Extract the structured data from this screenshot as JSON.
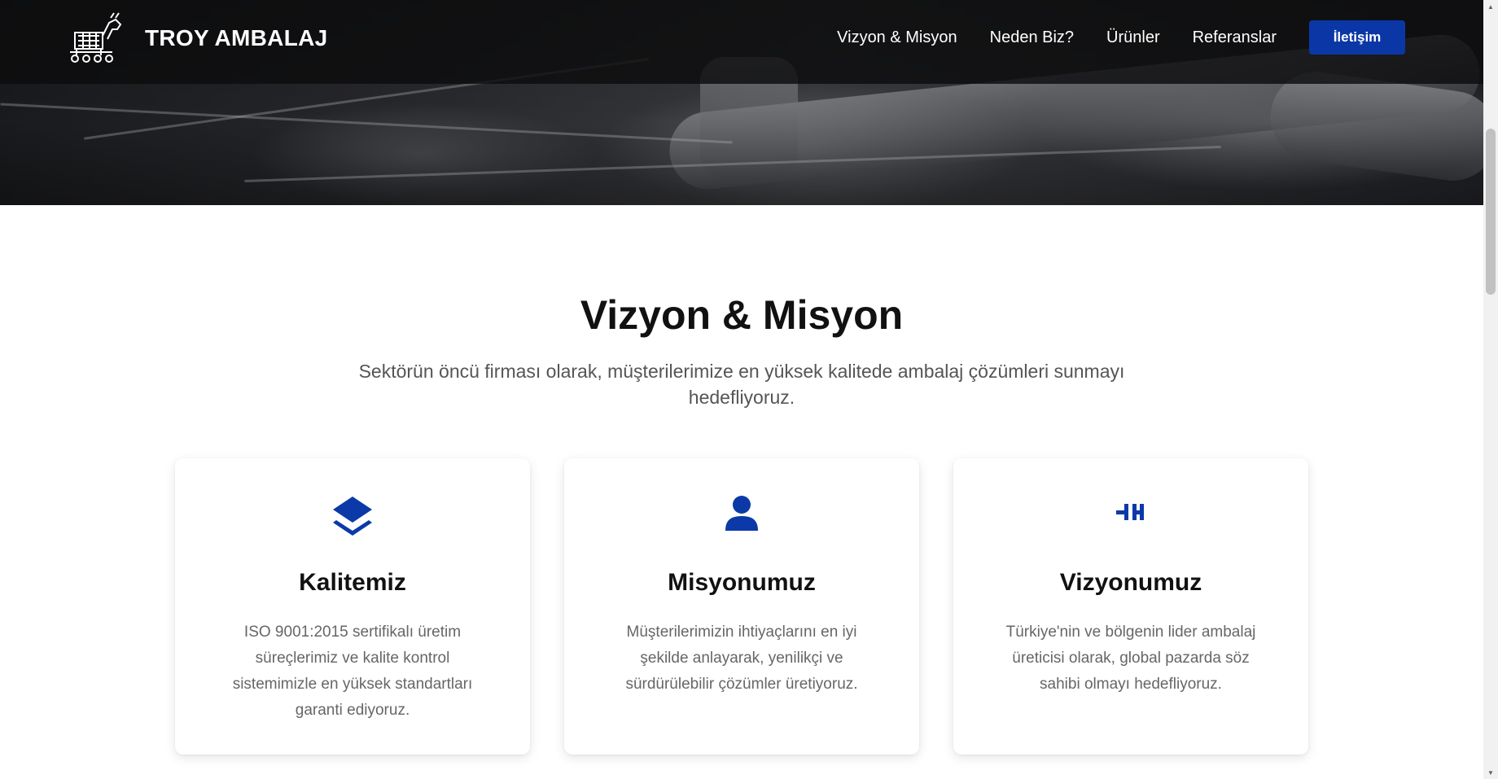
{
  "brand": {
    "name": "TROY AMBALAJ",
    "logo_icon": "trojan-horse-icon"
  },
  "nav": {
    "links": [
      "Vizyon & Misyon",
      "Neden Biz?",
      "Ürünler",
      "Referanslar"
    ],
    "cta_label": "İletişim"
  },
  "section": {
    "title": "Vizyon & Misyon",
    "subtitle": "Sektörün öncü firması olarak, müşterilerimize en yüksek kalitede ambalaj çözümleri sunmayı hedefliyoruz."
  },
  "cards": [
    {
      "icon": "layers-icon",
      "title": "Kalitemiz",
      "text": "ISO 9001:2015 sertifikalı üretim süreçlerimiz ve kalite kontrol sistemimizle en yüksek standartları garanti ediyoruz."
    },
    {
      "icon": "user-icon",
      "title": "Misyonumuz",
      "text": "Müşterilerimizin ihtiyaçlarını en iyi şekilde anlayarak, yenilikçi ve sürdürülebilir çözümler üretiyoruz."
    },
    {
      "icon": "vision-icon",
      "title": "Vizyonumuz",
      "text": "Türkiye'nin ve bölgenin lider ambalaj üreticisi olarak, global pazarda söz sahibi olmayı hedefliyoruz."
    }
  ],
  "colors": {
    "accent": "#0b37a6",
    "icon": "#0b3aa8",
    "navbar_bg": "#0c0c0d"
  }
}
